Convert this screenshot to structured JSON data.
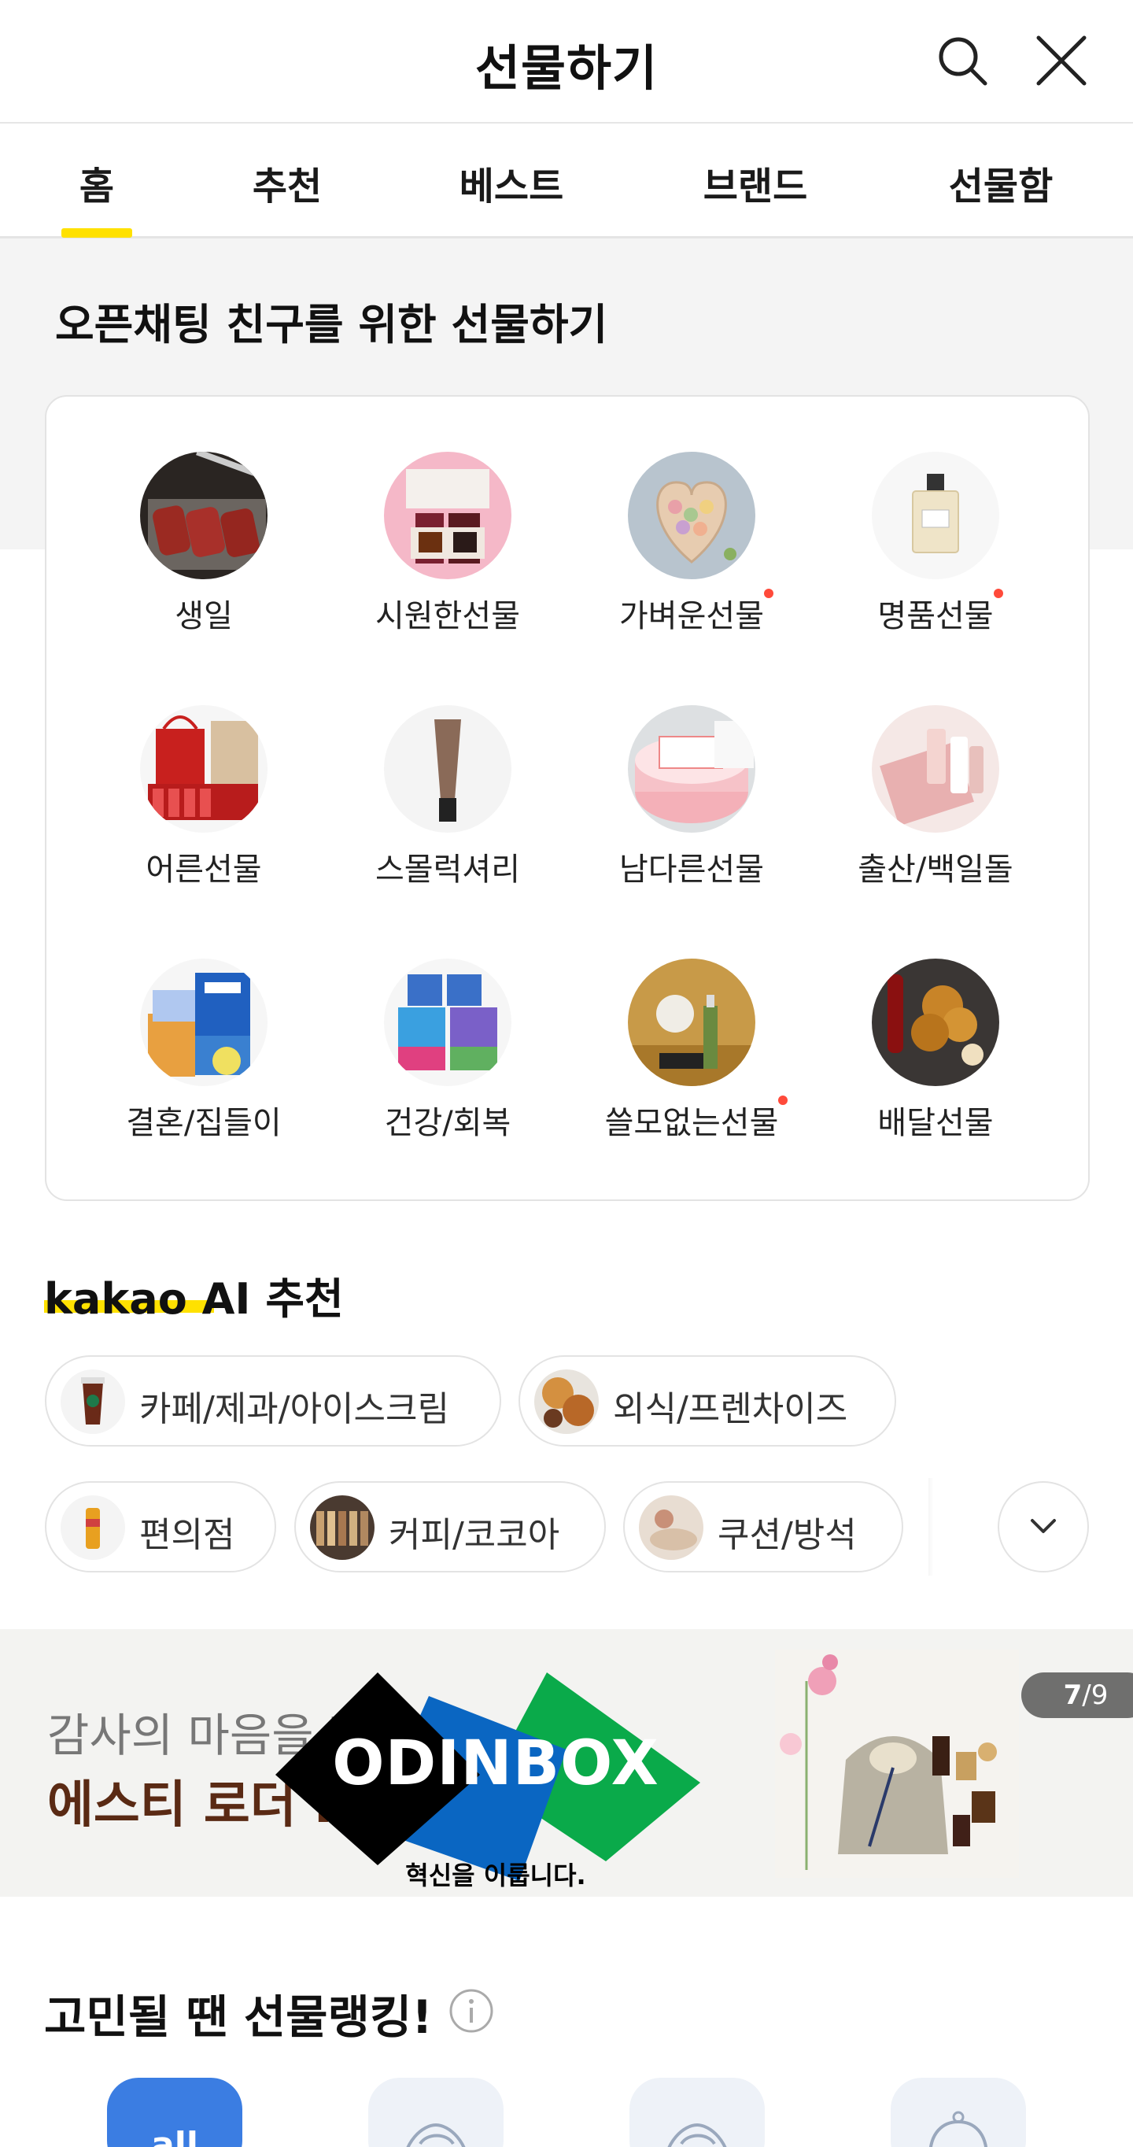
{
  "header": {
    "title": "선물하기"
  },
  "tabs": [
    {
      "label": "홈"
    },
    {
      "label": "추천"
    },
    {
      "label": "베스트"
    },
    {
      "label": "브랜드"
    },
    {
      "label": "선물함"
    }
  ],
  "section1": {
    "title": "오픈채팅 친구를 위한 선물하기",
    "categories": [
      {
        "label": "생일",
        "dot": false
      },
      {
        "label": "시원한선물",
        "dot": false
      },
      {
        "label": "가벼운선물",
        "dot": true
      },
      {
        "label": "명품선물",
        "dot": true
      },
      {
        "label": "어른선물",
        "dot": false
      },
      {
        "label": "스몰럭셔리",
        "dot": false
      },
      {
        "label": "남다른선물",
        "dot": false
      },
      {
        "label": "출산/백일돌",
        "dot": false
      },
      {
        "label": "결혼/집들이",
        "dot": false
      },
      {
        "label": "건강/회복",
        "dot": false
      },
      {
        "label": "쓸모없는선물",
        "dot": true
      },
      {
        "label": "배달선물",
        "dot": false
      }
    ]
  },
  "ai": {
    "brand": "kakao AI",
    "suffix": "추천",
    "chips": [
      {
        "label": "카페/제과/아이스크림"
      },
      {
        "label": "외식/프렌차이즈"
      },
      {
        "label": "편의점"
      },
      {
        "label": "커피/코코아"
      },
      {
        "label": "쿠션/방석"
      }
    ]
  },
  "banner": {
    "subtitle": "감사의 마음을 전",
    "headline": "에스티 로더 I",
    "page_current": "7",
    "page_total": "/9",
    "overlay_brand": "ODINBOX",
    "overlay_tagline": "혁신을 이룹니다."
  },
  "ranking": {
    "title": "고민될 땐 선물랭킹!",
    "first_label": "all"
  },
  "colors": {
    "accent_yellow": "#ffe100",
    "notification_dot": "#ff4a3a",
    "ranking_active": "#3b7de2",
    "banner_headline": "#5a2a14"
  }
}
